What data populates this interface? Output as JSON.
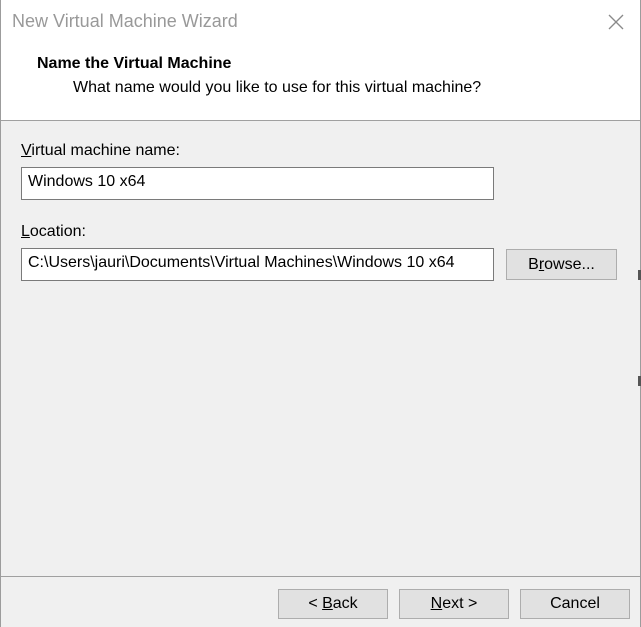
{
  "window": {
    "title": "New Virtual Machine Wizard"
  },
  "header": {
    "title": "Name the Virtual Machine",
    "subtitle": "What name would you like to use for this virtual machine?"
  },
  "form": {
    "name_label_accel": "V",
    "name_label_rest": "irtual machine name:",
    "name_value": "Windows 10 x64",
    "location_label_accel": "L",
    "location_label_rest": "ocation:",
    "location_value": "C:\\Users\\jauri\\Documents\\Virtual Machines\\Windows 10 x64",
    "browse_accel_pre": "B",
    "browse_accel": "r",
    "browse_rest": "owse..."
  },
  "footer": {
    "back_pre": "< ",
    "back_accel": "B",
    "back_rest": "ack",
    "next_accel": "N",
    "next_rest": "ext >",
    "cancel_label": "Cancel"
  },
  "icons": {
    "close": "close-icon"
  }
}
